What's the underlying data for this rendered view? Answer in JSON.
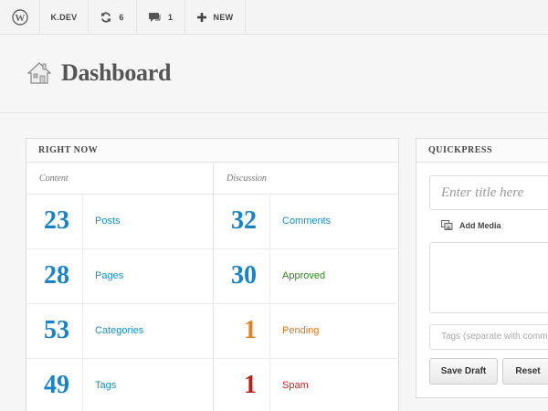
{
  "adminbar": {
    "site_name": "K.DEV",
    "updates_count": "6",
    "comments_count": "1",
    "new_label": "NEW"
  },
  "header": {
    "title": "Dashboard"
  },
  "right_now": {
    "title": "RIGHT NOW",
    "content": {
      "label": "Content",
      "rows": [
        {
          "count": "23",
          "label": "Posts"
        },
        {
          "count": "28",
          "label": "Pages"
        },
        {
          "count": "53",
          "label": "Categories"
        },
        {
          "count": "49",
          "label": "Tags"
        }
      ]
    },
    "discussion": {
      "label": "Discussion",
      "rows": [
        {
          "count": "32",
          "label": "Comments"
        },
        {
          "count": "30",
          "label": "Approved"
        },
        {
          "count": "1",
          "label": "Pending"
        },
        {
          "count": "1",
          "label": "Spam"
        }
      ]
    }
  },
  "quickpress": {
    "title": "QUICKPRESS",
    "title_placeholder": "Enter title here",
    "add_media_label": "Add Media",
    "tags_placeholder": "Tags (separate with commas)",
    "save_draft_label": "Save Draft",
    "reset_label": "Reset"
  },
  "colors": {
    "link_blue": "#1e8cbe",
    "count_blue": "#1b82c6",
    "approved_green": "#2b8a18",
    "pending_orange": "#d9761a",
    "spam_red": "#c42525",
    "pending_count_orange": "#e08419",
    "spam_count_red": "#b8201e"
  }
}
